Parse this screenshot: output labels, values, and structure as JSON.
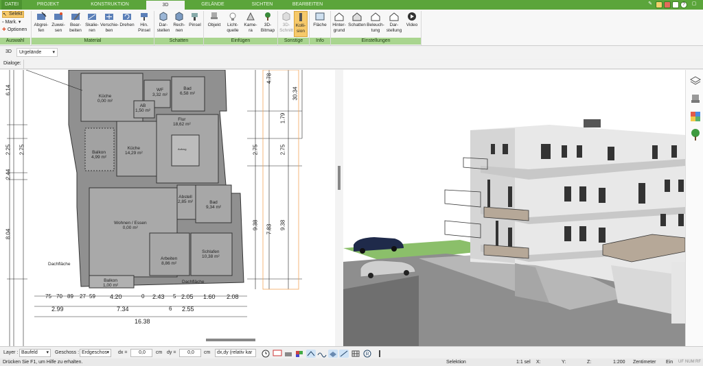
{
  "tabs": [
    {
      "label": "DATEI"
    },
    {
      "label": "PROJEKT"
    },
    {
      "label": "KONSTRUKTION"
    },
    {
      "label": "3D"
    },
    {
      "label": "GELÄNDE"
    },
    {
      "label": "SICHTEN"
    },
    {
      "label": "BEARBEITEN"
    }
  ],
  "selection": {
    "select_label": "Selekt",
    "mark_label": "Mark.",
    "options_label": "Optionen",
    "group_label": "Auswahl"
  },
  "material": {
    "buttons": [
      "Abgrei-\nfen",
      "Zuwei-\nsen",
      "Bear-\nbeiten",
      "Skalie-\nren",
      "Verschie-\nben",
      "Drehen",
      "Hin.\nPinsel"
    ],
    "group_label": "Material"
  },
  "shadows": {
    "buttons": [
      "Dar-\nstellen",
      "Rech-\nnen",
      "Pinsel"
    ],
    "group_label": "Schatten"
  },
  "insert": {
    "buttons": [
      "Objekt",
      "Licht-\nquelle",
      "Kame-\nra",
      "3D-\nBitmap"
    ],
    "group_label": "Einfügen"
  },
  "other": {
    "buttons": [
      "3D-\nSchnitt",
      "Kolli-\nsion"
    ],
    "group_label": "Sonstige"
  },
  "info": {
    "buttons": [
      "Fläche"
    ],
    "group_label": "Info"
  },
  "settings": {
    "buttons": [
      "Hinter-\ngrund",
      "Schatten",
      "Beleuch-\ntung",
      "Dar-\nstellung",
      "Video"
    ],
    "group_label": "Einstellungen"
  },
  "viewbar": {
    "mode": "3D",
    "terrain_select": "Urgelände"
  },
  "dialog_label": "Dialoge:",
  "plan": {
    "rooms": [
      {
        "name": "Küche",
        "area": "0,00 m²"
      },
      {
        "name": "WF",
        "area": "3,32 m²"
      },
      {
        "name": "Bad",
        "area": "6,58 m²"
      },
      {
        "name": "AB",
        "area": "1,50 m²"
      },
      {
        "name": "Flur",
        "area": "18,62 m²"
      },
      {
        "name": "Balkon",
        "area": "4,99 m²"
      },
      {
        "name": "Küche",
        "area": "14,29 m²"
      },
      {
        "name": "Abstell",
        "area": "2,85 m²"
      },
      {
        "name": "Bad",
        "area": "9,34 m²"
      },
      {
        "name": "Wohnen / Essen",
        "area": "0,00 m²"
      },
      {
        "name": "Arbeiten",
        "area": "8,86 m²"
      },
      {
        "name": "Schlafen",
        "area": "10,38 m²"
      },
      {
        "name": "Balkon",
        "area": "1,00 m²"
      }
    ],
    "labels": {
      "dach1": "Dachfläche",
      "dach2": "Dachfläche",
      "lift": "Aufzug"
    },
    "dims_left": [
      "6.14",
      "2.25",
      "2.75",
      "2.44",
      "8.04"
    ],
    "dims_right": [
      "4.78",
      "30.34",
      "1.79",
      "2.75",
      "2.75",
      "9.38",
      "9.38",
      "7.83"
    ],
    "dims_bottom_row1": [
      "75",
      "70",
      "89",
      "27",
      "59",
      "4.20",
      "0",
      "2.43",
      "5",
      "2.05",
      "1.60",
      "2.08"
    ],
    "dims_bottom_row2": [
      "2.99",
      "7.34",
      "6",
      "2.55"
    ],
    "dims_bottom_row3": "16.38"
  },
  "bottombar": {
    "layer_label": "Layer :",
    "layer_value": "Baufeld",
    "floor_label": "Geschoss :",
    "floor_value": "Erdgeschos",
    "dx_label": "dx =",
    "dx_value": "0,0",
    "dx_unit": "cm",
    "dy_label": "dy =",
    "dy_value": "0,0",
    "dy_unit": "cm",
    "mode_value": "dx,dy (relativ kar"
  },
  "statusbar": {
    "help": "Drücken Sie F1, um Hilfe zu erhalten.",
    "mode": "Selektion",
    "sel": "1:1 sel",
    "x": "X:",
    "y": "Y:",
    "z": "Z:",
    "scale": "1:200",
    "unit": "Zentimeter",
    "ein": "Ein",
    "uf": "UF",
    "num": "NUM",
    "rf": "RF"
  },
  "colors": {
    "accent": "#5ba53b",
    "group": "#a9d58f",
    "active": "#f6c96a"
  }
}
